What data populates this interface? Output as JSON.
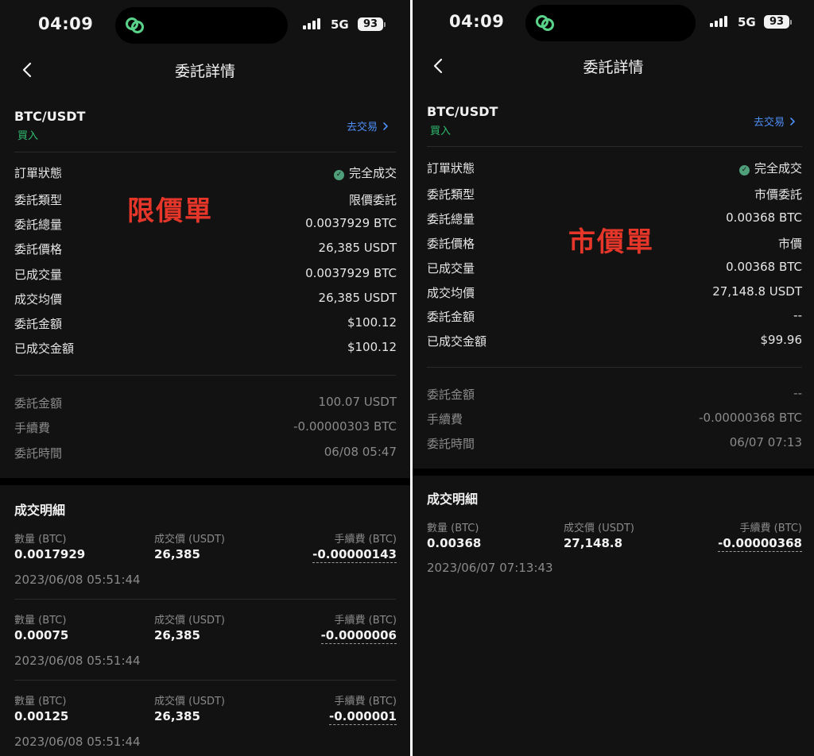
{
  "left": {
    "status_bar": {
      "time": "04:09",
      "network": "5G",
      "battery": "93"
    },
    "header": {
      "title": "委託詳情"
    },
    "order": {
      "pair": "BTC/USDT",
      "side": "買入",
      "trade_link": "去交易"
    },
    "annotation": "限價單",
    "rows": [
      {
        "label": "訂單狀態",
        "value": "完全成交"
      },
      {
        "label": "委託類型",
        "value": "限價委託"
      },
      {
        "label": "委託總量",
        "value": "0.0037929 BTC"
      },
      {
        "label": "委託價格",
        "value": "26,385 USDT"
      },
      {
        "label": "已成交量",
        "value": "0.0037929 BTC"
      },
      {
        "label": "成交均價",
        "value": "26,385 USDT"
      },
      {
        "label": "委託金額",
        "value": "$100.12"
      },
      {
        "label": "已成交金額",
        "value": "$100.12"
      }
    ],
    "secondary_rows": [
      {
        "label": "委託金額",
        "value": "100.07 USDT"
      },
      {
        "label": "手續費",
        "value": "-0.00000303 BTC"
      },
      {
        "label": "委託時間",
        "value": "06/08 05:47"
      }
    ],
    "fills": {
      "title": "成交明細",
      "headers": {
        "qty": "數量 (BTC)",
        "price": "成交價 (USDT)",
        "fee": "手續費 (BTC)"
      },
      "items": [
        {
          "qty": "0.0017929",
          "price": "26,385",
          "fee": "-0.00000143",
          "time": "2023/06/08 05:51:44"
        },
        {
          "qty": "0.00075",
          "price": "26,385",
          "fee": "-0.0000006",
          "time": "2023/06/08 05:51:44"
        },
        {
          "qty": "0.00125",
          "price": "26,385",
          "fee": "-0.000001",
          "time": "2023/06/08 05:51:44"
        }
      ]
    }
  },
  "right": {
    "status_bar": {
      "time": "04:09",
      "network": "5G",
      "battery": "93"
    },
    "header": {
      "title": "委託詳情"
    },
    "order": {
      "pair": "BTC/USDT",
      "side": "買入",
      "trade_link": "去交易"
    },
    "annotation": "市價單",
    "rows": [
      {
        "label": "訂單狀態",
        "value": "完全成交"
      },
      {
        "label": "委託類型",
        "value": "市價委託"
      },
      {
        "label": "委託總量",
        "value": "0.00368 BTC"
      },
      {
        "label": "委託價格",
        "value": "市價"
      },
      {
        "label": "已成交量",
        "value": "0.00368 BTC"
      },
      {
        "label": "成交均價",
        "value": "27,148.8 USDT"
      },
      {
        "label": "委託金額",
        "value": "--"
      },
      {
        "label": "已成交金額",
        "value": "$99.96"
      }
    ],
    "secondary_rows": [
      {
        "label": "委託金額",
        "value": "--"
      },
      {
        "label": "手續費",
        "value": "-0.00000368 BTC"
      },
      {
        "label": "委託時間",
        "value": "06/07 07:13"
      }
    ],
    "fills": {
      "title": "成交明細",
      "headers": {
        "qty": "數量 (BTC)",
        "price": "成交價 (USDT)",
        "fee": "手續費 (BTC)"
      },
      "items": [
        {
          "qty": "0.00368",
          "price": "27,148.8",
          "fee": "-0.00000368",
          "time": "2023/06/07 07:13:43"
        }
      ]
    }
  },
  "colors": {
    "background": "#121212",
    "separator_band": "#000000",
    "buy_green": "#2fbf71",
    "link_blue": "#4d8ef7",
    "annotation_red": "#e53629",
    "status_check": "#4fa07a"
  },
  "icons": {
    "back": "chevron-left-icon",
    "trade_link": "chevron-right-icon",
    "island": "linked-rings-icon",
    "status": "check-circle-icon",
    "signal": "cellular-signal-icon",
    "battery": "battery-icon"
  }
}
